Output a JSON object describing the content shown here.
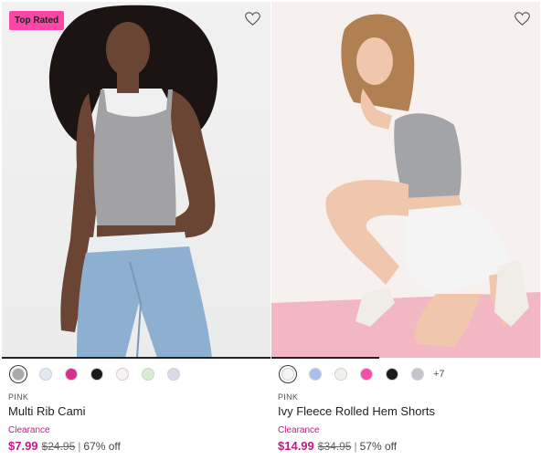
{
  "products": [
    {
      "badge": "Top Rated",
      "brand": "PINK",
      "name": "Multi Rib Cami",
      "status": "Clearance",
      "sale_price": "$7.99",
      "original_price": "$24.95",
      "separator": "|",
      "discount": "67% off",
      "swatch_colors": [
        "#a9a9a9",
        "#e3e8f3",
        "#d72f8c",
        "#1b1b1b",
        "#f6f2f2",
        "#d7ecd2",
        "#d9d9e8"
      ],
      "more_colors": ""
    },
    {
      "badge": "",
      "brand": "PINK",
      "name": "Ivy Fleece Rolled Hem Shorts",
      "status": "Clearance",
      "sale_price": "$14.99",
      "original_price": "$34.95",
      "separator": "|",
      "discount": "57% off",
      "swatch_colors": [
        "#f5f5f5",
        "#a9c0ee",
        "#f1f1ec",
        "#f24fa5",
        "#1b1b1b",
        "#c3c4cd"
      ],
      "more_colors": "+7"
    }
  ],
  "colors": {
    "badge_bg": "#ff46a8",
    "price_accent": "#c41a85"
  },
  "icons": {
    "wishlist": "heart-icon"
  }
}
